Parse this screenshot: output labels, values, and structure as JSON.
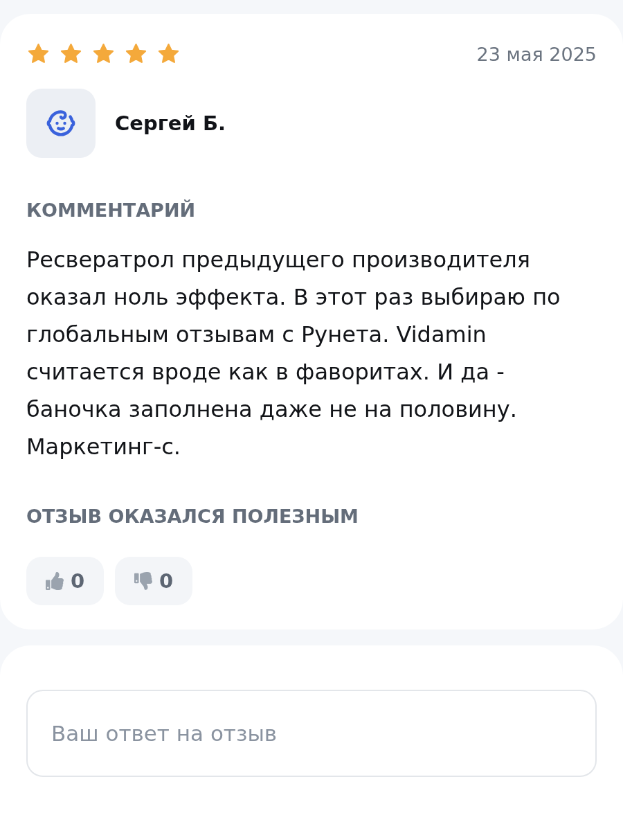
{
  "review": {
    "stars": 5,
    "date": "23 мая 2025",
    "author": {
      "name": "Сергей Б."
    },
    "comment": {
      "heading": "КОММЕНТАРИЙ",
      "text": "Ресвератрол предыдущего производителя оказал ноль эффекта. В этот раз выбираю по глобальным отзывам с Рунета. Vidamin считается вроде как в фаворитах. И да - баночка заполнена даже не на половину. Маркетинг-с."
    },
    "helpful": {
      "heading": "ОТЗЫВ ОКАЗАЛСЯ ПОЛЕЗНЫМ",
      "votes": [
        {
          "kind": "like",
          "count": "0"
        },
        {
          "kind": "dislike",
          "count": "0"
        }
      ]
    }
  },
  "reply": {
    "placeholder": "Ваш ответ на отзыв"
  }
}
